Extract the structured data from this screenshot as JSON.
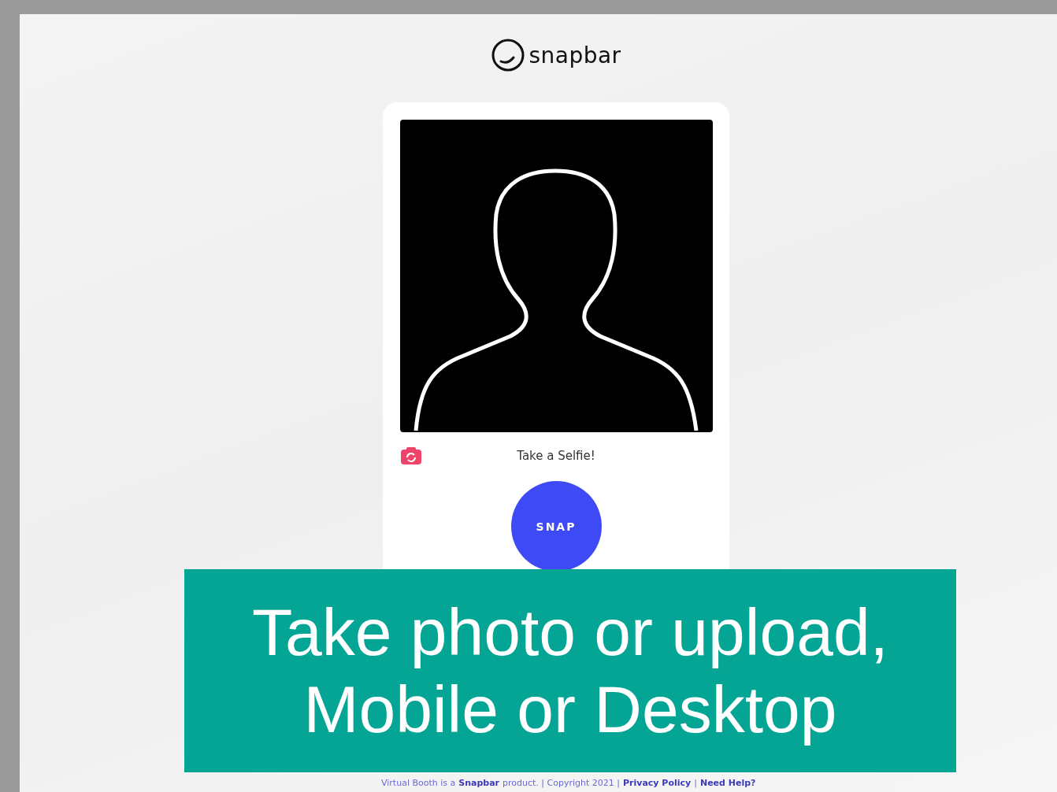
{
  "logo": {
    "text": "snapbar"
  },
  "camera": {
    "caption": "Take a Selfie!"
  },
  "snap_button": {
    "label": "SNAP"
  },
  "banner": {
    "lines": [
      "Take photo or upload,",
      "Mobile or Desktop"
    ]
  },
  "footer": [
    {
      "kind": "text",
      "text": "Virtual Booth is a"
    },
    {
      "kind": "link",
      "text": "Snapbar"
    },
    {
      "kind": "text",
      "text": "product. | Copyright 2021 |"
    },
    {
      "kind": "link",
      "text": "Privacy Policy"
    },
    {
      "kind": "text",
      "text": "|"
    },
    {
      "kind": "link",
      "text": "Need Help?"
    }
  ]
}
